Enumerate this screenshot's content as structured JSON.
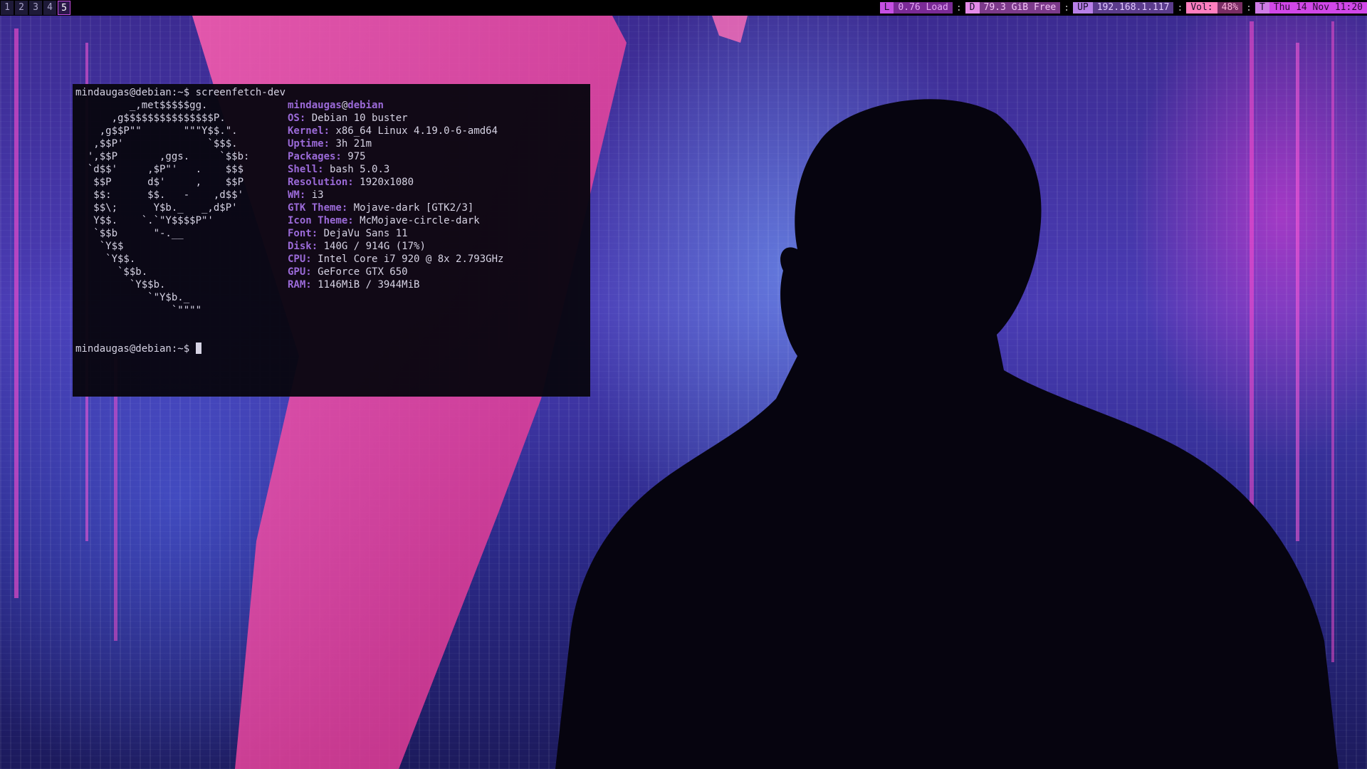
{
  "workspaces": [
    {
      "label": "1",
      "active": false
    },
    {
      "label": "2",
      "active": false
    },
    {
      "label": "3",
      "active": false
    },
    {
      "label": "4",
      "active": false
    },
    {
      "label": "5",
      "active": true
    }
  ],
  "status_bar": {
    "load": {
      "tag": "L",
      "value": "0.76 Load",
      "tag_color": "#c64fe3",
      "value_color": "#c64fe3"
    },
    "disk": {
      "tag": "D",
      "value": "79.3 GiB Free",
      "tag_color": "#e58be9",
      "value_color": "#e58be9"
    },
    "ip": {
      "tag": "UP",
      "value": "192.168.1.117",
      "tag_color": "#b880e8",
      "value_color": "#b880e8"
    },
    "volume": {
      "tag": "Vol:",
      "value": "48%",
      "tag_color": "#ff7fbf",
      "value_color": "#ff7fbf"
    },
    "time": {
      "tag": "T",
      "value": "Thu 14 Nov 11:20",
      "tag_color": "#cf7ce6",
      "value_color": "#d147e8"
    },
    "separator": ":"
  },
  "terminal": {
    "prompt": "mindaugas@debian:~$ ",
    "command": "screenfetch-dev",
    "logo_lines": [
      "         _,met$$$$$gg.",
      "      ,g$$$$$$$$$$$$$$$P.",
      "    ,g$$P\"\"       \"\"\"Y$$.\".",
      "   ,$$P'              `$$$.",
      "  ',$$P       ,ggs.     `$$b:",
      "  `d$$'     ,$P\"'   .    $$$",
      "   $$P      d$'     ,    $$P",
      "   $$:      $$.   -    ,d$$'",
      "   $$\\;      Y$b._   _,d$P'",
      "   Y$$.    `.`\"Y$$$$P\"'",
      "   `$$b      \"-.__",
      "    `Y$$",
      "     `Y$$.",
      "       `$$b.",
      "         `Y$$b.",
      "            `\"Y$b._",
      "                `\"\"\"\""
    ],
    "user": "mindaugas",
    "at": "@",
    "host": "debian",
    "info": [
      {
        "key": "OS:",
        "value": "Debian 10 buster"
      },
      {
        "key": "Kernel:",
        "value": "x86_64 Linux 4.19.0-6-amd64"
      },
      {
        "key": "Uptime:",
        "value": "3h 21m"
      },
      {
        "key": "Packages:",
        "value": "975"
      },
      {
        "key": "Shell:",
        "value": "bash 5.0.3"
      },
      {
        "key": "Resolution:",
        "value": "1920x1080"
      },
      {
        "key": "WM:",
        "value": "i3"
      },
      {
        "key": "GTK Theme:",
        "value": "Mojave-dark [GTK2/3]"
      },
      {
        "key": "Icon Theme:",
        "value": "McMojave-circle-dark"
      },
      {
        "key": "Font:",
        "value": "DejaVu Sans 11"
      },
      {
        "key": "Disk:",
        "value": "140G / 914G (17%)"
      },
      {
        "key": "CPU:",
        "value": "Intel Core i7 920 @ 8x 2.793GHz"
      },
      {
        "key": "GPU:",
        "value": "GeForce GTX 650"
      },
      {
        "key": "RAM:",
        "value": "1146MiB / 3944MiB"
      }
    ],
    "prompt2": "mindaugas@debian:~$ "
  }
}
